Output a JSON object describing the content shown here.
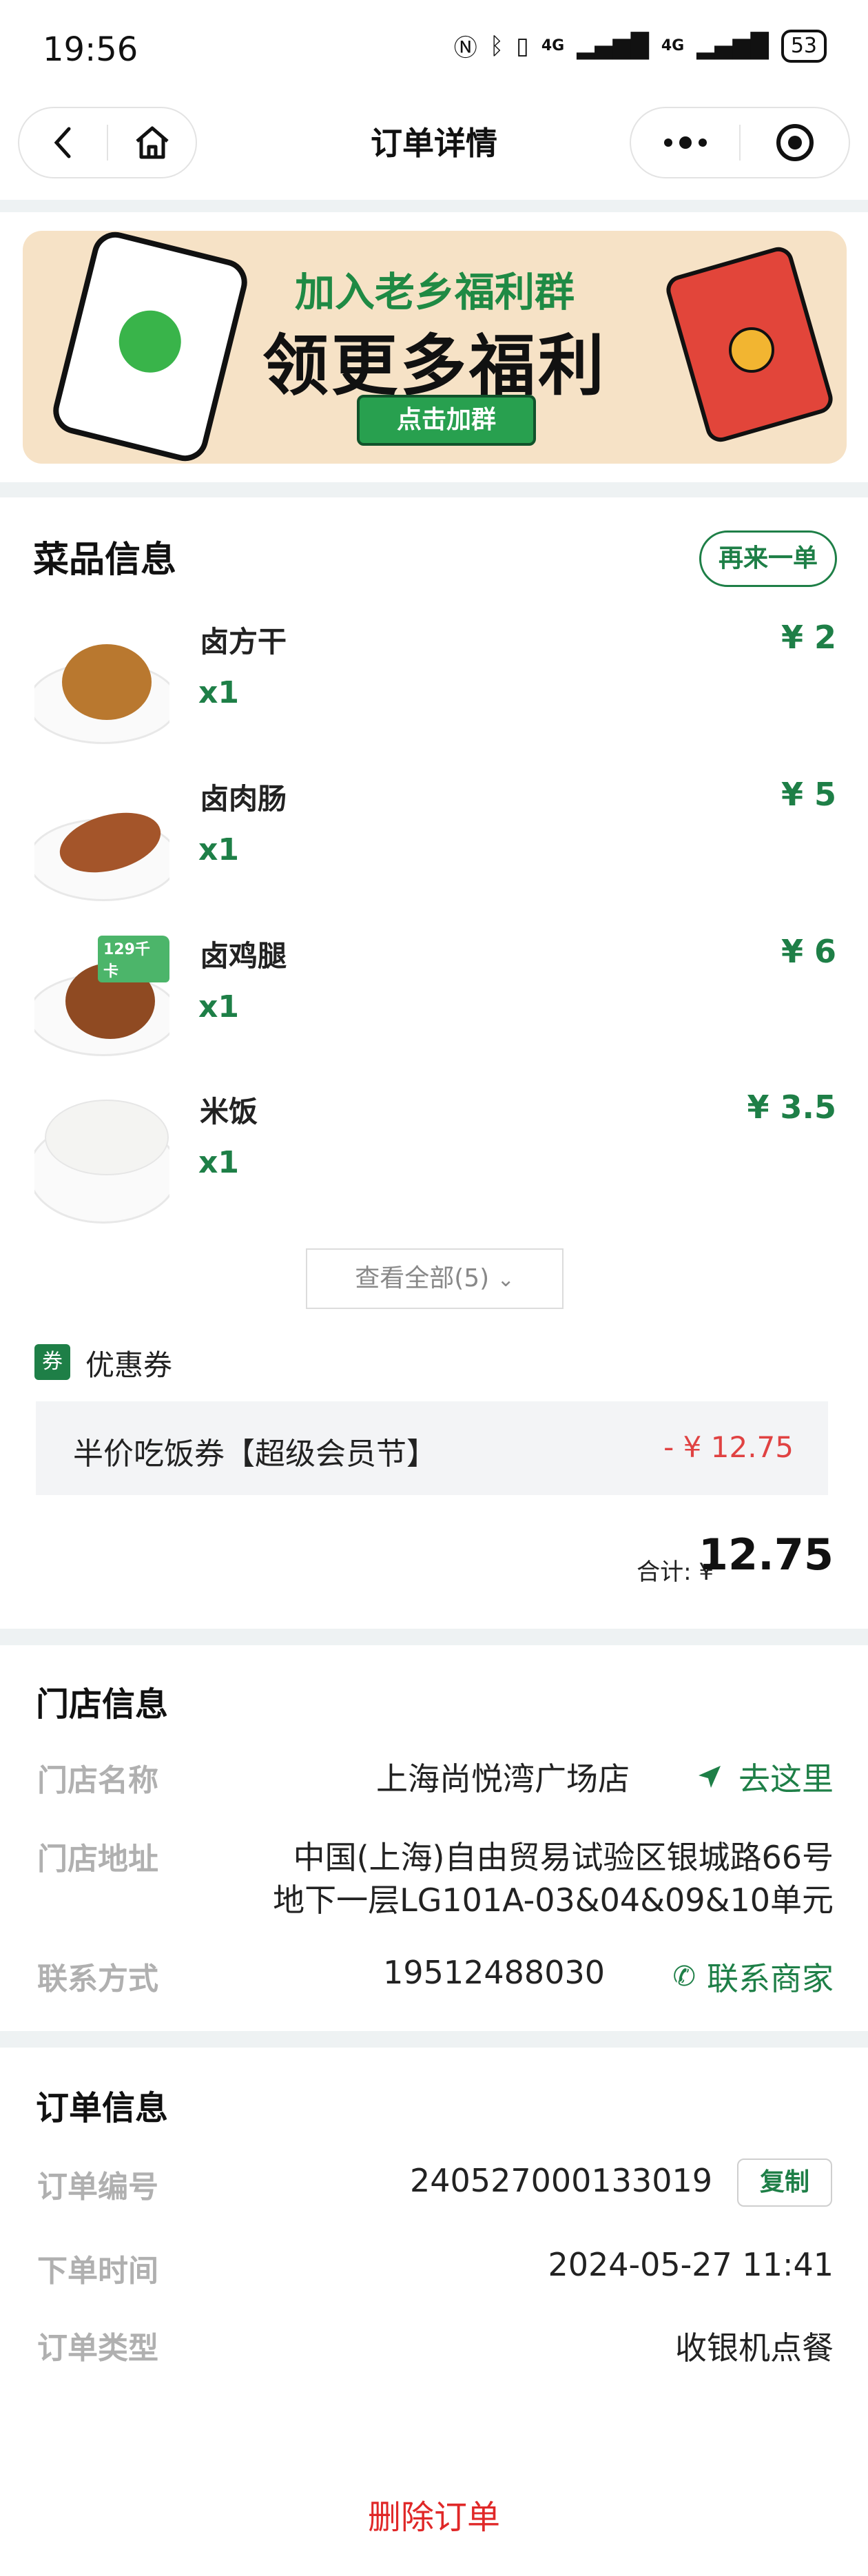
{
  "status_bar": {
    "time": "19:56",
    "battery": "53",
    "net1": "4G",
    "net2": "4G"
  },
  "nav": {
    "title": "订单详情"
  },
  "banner": {
    "line1": "加入老乡福利群",
    "line2": "领更多福利",
    "button": "点击加群"
  },
  "dishes": {
    "title": "菜品信息",
    "reorder_label": "再来一单",
    "items": [
      {
        "name": "卤方干",
        "qty": "x1",
        "price": "¥ 2",
        "badge": ""
      },
      {
        "name": "卤肉肠",
        "qty": "x1",
        "price": "¥ 5",
        "badge": ""
      },
      {
        "name": "卤鸡腿",
        "qty": "x1",
        "price": "¥ 6",
        "badge": "129千卡"
      },
      {
        "name": "米饭",
        "qty": "x1",
        "price": "¥ 3.5",
        "badge": ""
      }
    ],
    "view_all": "查看全部(5)"
  },
  "coupon": {
    "icon_text": "券",
    "title": "优惠券",
    "name": "半价吃饭券【超级会员节】",
    "amount": "- ¥ 12.75"
  },
  "total": {
    "label": "合计: ¥",
    "value": "12.75"
  },
  "store": {
    "title": "门店信息",
    "name_label": "门店名称",
    "name": "上海尚悦湾广场店",
    "goto": "去这里",
    "address_label": "门店地址",
    "address_line1": "中国(上海)自由贸易试验区银城路66号",
    "address_line2": "地下一层LG101A-03&04&09&10单元",
    "contact_label": "联系方式",
    "phone": "19512488030",
    "contact_link": "联系商家"
  },
  "order": {
    "title": "订单信息",
    "no_label": "订单编号",
    "no": "240527000133019",
    "copy": "复制",
    "time_label": "下单时间",
    "time": "2024-05-27 11:41",
    "type_label": "订单类型",
    "type": "收银机点餐"
  },
  "delete_label": "删除订单",
  "colors": {
    "accent_green": "#1e7f47",
    "danger_red": "#e02828",
    "section_gray": "#eef2f3"
  }
}
